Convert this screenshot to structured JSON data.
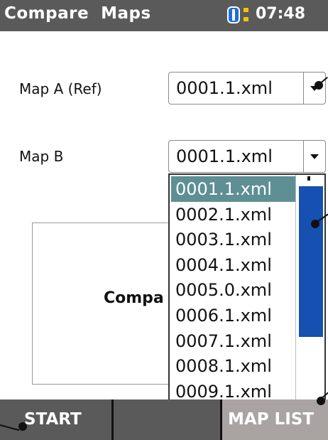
{
  "header": {
    "title": "Compare  Maps",
    "clock": "07:48",
    "battery_icon": "battery-icon"
  },
  "map_a": {
    "label": "Map A (Ref)",
    "value": "0001.1.xml"
  },
  "map_b": {
    "label": "Map B",
    "value": "0001.1.xml",
    "options": [
      "0001.1.xml",
      "0002.1.xml",
      "0003.1.xml",
      "0004.1.xml",
      "0005.0.xml",
      "0006.1.xml",
      "0007.1.xml",
      "0008.1.xml",
      "0009.1.xml"
    ],
    "selected_index": 0
  },
  "panel": {
    "text": "Compa"
  },
  "softkeys": {
    "start": "START",
    "middle": "",
    "map_list": "MAP LIST"
  },
  "colors": {
    "titlebar": "#5a5a5a",
    "selection": "#5e8f95",
    "scroll_thumb": "#1650b0",
    "map_list_key": "#a9a4a2"
  }
}
